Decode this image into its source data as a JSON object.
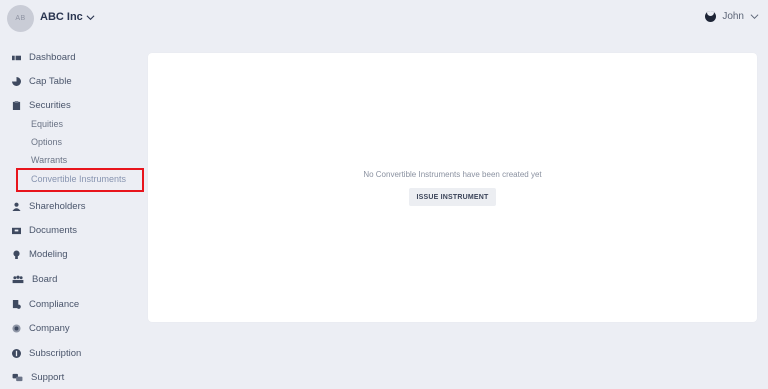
{
  "header": {
    "avatar_initials": "AB",
    "company_name": "ABC Inc",
    "user_name": "John"
  },
  "sidebar": {
    "items": [
      {
        "label": "Dashboard",
        "icon": "dashboard-icon"
      },
      {
        "label": "Cap Table",
        "icon": "pie-chart-icon"
      },
      {
        "label": "Securities",
        "icon": "clipboard-icon"
      },
      {
        "label": "Shareholders",
        "icon": "person-icon"
      },
      {
        "label": "Documents",
        "icon": "folder-icon"
      },
      {
        "label": "Modeling",
        "icon": "lightbulb-icon"
      },
      {
        "label": "Board",
        "icon": "group-icon"
      },
      {
        "label": "Compliance",
        "icon": "document-check-icon"
      },
      {
        "label": "Company",
        "icon": "gear-icon"
      },
      {
        "label": "Subscription",
        "icon": "dollar-icon"
      },
      {
        "label": "Support",
        "icon": "support-icon"
      }
    ],
    "securities_sub": [
      "Equities",
      "Options",
      "Warrants",
      "Convertible Instruments"
    ],
    "active_item": "Convertible Instruments"
  },
  "main": {
    "empty_message": "No Convertible Instruments have been created yet",
    "issue_button_label": "ISSUE INSTRUMENT"
  },
  "colors": {
    "background": "#eceef4",
    "card": "#ffffff",
    "highlight_border": "#e8141c"
  }
}
